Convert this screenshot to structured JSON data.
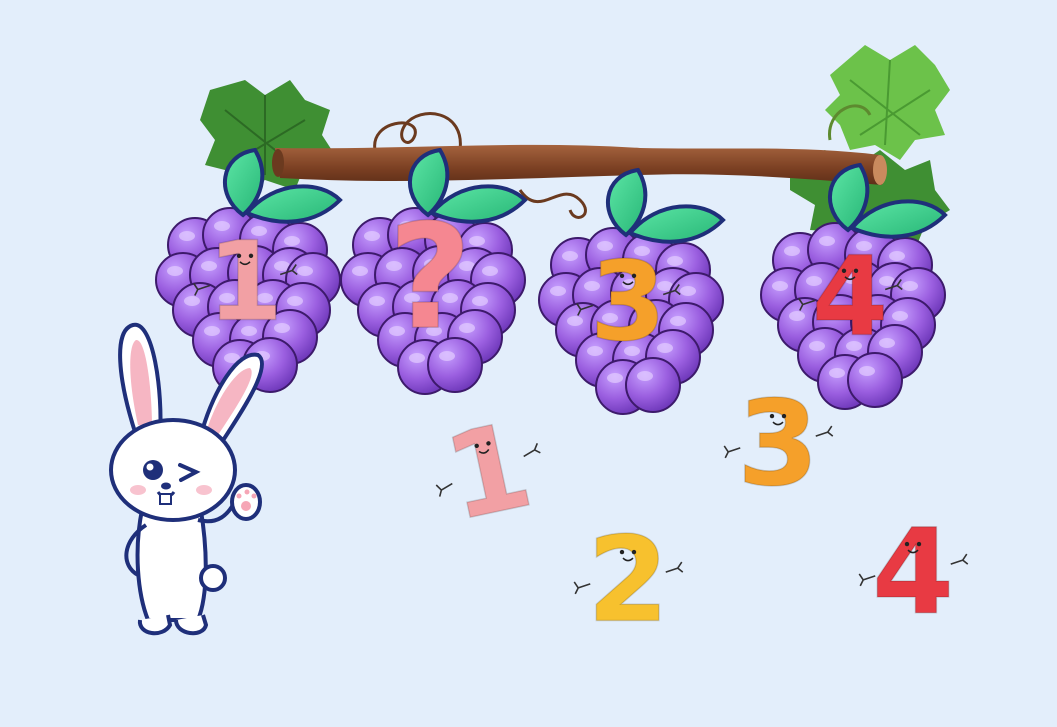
{
  "vine_slots": [
    {
      "label": "1",
      "color": "#f2a0a4"
    },
    {
      "label": "?",
      "color": "#f58791"
    },
    {
      "label": "3",
      "color": "#f5a02a"
    },
    {
      "label": "4",
      "color": "#e83a43"
    }
  ],
  "answer_options": [
    {
      "label": "1",
      "color": "#f2a0a4"
    },
    {
      "label": "2",
      "color": "#f7c12e"
    },
    {
      "label": "3",
      "color": "#f5a02a"
    },
    {
      "label": "4",
      "color": "#e83a43"
    }
  ],
  "colors": {
    "background": "#e3eefb",
    "grape": "#9b5fe0",
    "grape_dark": "#3d1a6b",
    "leaf": "#3fcf8e",
    "branch": "#8a4a2c",
    "vine_leaf": "#3f8f33"
  },
  "character": "bunny-waving"
}
